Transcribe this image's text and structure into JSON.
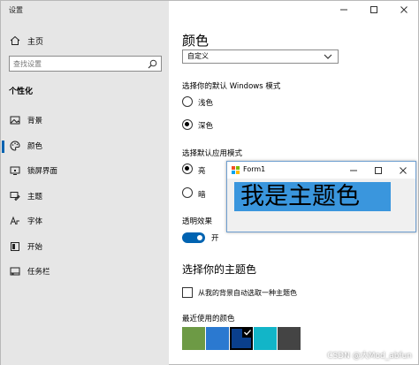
{
  "window": {
    "title": "设置"
  },
  "sidebar": {
    "home": "主页",
    "search_placeholder": "查找设置",
    "section": "个性化",
    "items": [
      {
        "label": "背景",
        "icon": "picture-icon"
      },
      {
        "label": "颜色",
        "icon": "palette-icon",
        "active": true
      },
      {
        "label": "锁屏界面",
        "icon": "lock-screen-icon"
      },
      {
        "label": "主题",
        "icon": "brush-icon"
      },
      {
        "label": "字体",
        "icon": "font-icon"
      },
      {
        "label": "开始",
        "icon": "start-icon"
      },
      {
        "label": "任务栏",
        "icon": "taskbar-icon"
      }
    ]
  },
  "content": {
    "title": "颜色",
    "dropdown_value": "自定义",
    "windows_mode": {
      "label": "选择你的默认 Windows 模式",
      "options": [
        {
          "label": "浅色",
          "selected": false
        },
        {
          "label": "深色",
          "selected": true
        }
      ]
    },
    "app_mode": {
      "label": "选择默认应用模式",
      "options": [
        {
          "label": "亮",
          "selected": true
        },
        {
          "label": "暗",
          "selected": false
        }
      ]
    },
    "transparency": {
      "label": "透明效果",
      "state": "开",
      "on": true
    },
    "accent_title": "选择你的主题色",
    "auto_accent": "从我的背景自动选取一种主题色",
    "recent_label": "最近使用的颜色",
    "recent_colors": [
      "#6d9a45",
      "#2b79d0",
      "#0a3f8c",
      "#12b5c8",
      "#444444"
    ],
    "selected_color_index": 2
  },
  "form1": {
    "title": "Form1",
    "label": "我是主题色",
    "label_bg": "#3a96dd"
  },
  "watermark": "CSDN @大Mod_abfun"
}
